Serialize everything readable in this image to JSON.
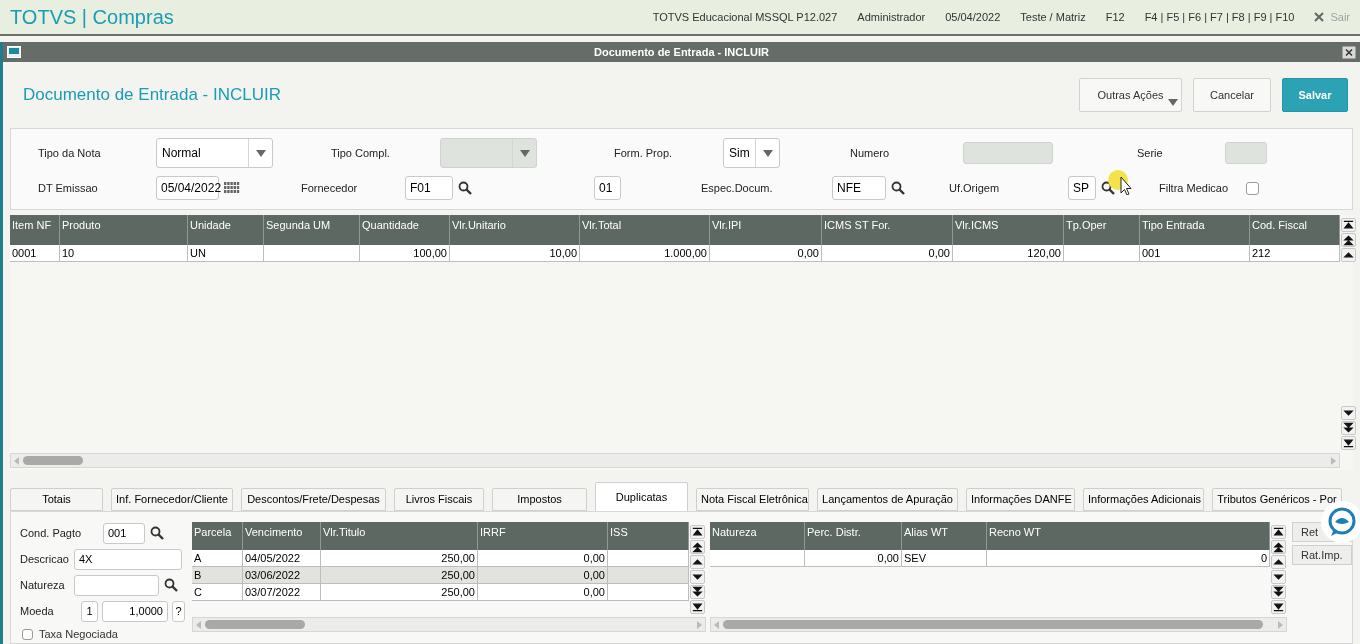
{
  "app_bar": {
    "title": "TOTVS | Compras",
    "items": [
      "TOTVS Educacional MSSQL P12.027",
      "Administrador",
      "05/04/2022",
      "Teste / Matriz",
      "F12",
      "F4 | F5 | F6 | F7 | F8 | F9 | F10"
    ],
    "exit": {
      "label": "Sair",
      "disabled": true
    }
  },
  "window": {
    "title": "Documento de Entrada - INCLUIR"
  },
  "header": {
    "title": "Documento de Entrada - INCLUIR",
    "buttons": [
      {
        "label": "Outras Ações",
        "kind": "menu"
      },
      {
        "label": "Cancelar",
        "kind": "default"
      },
      {
        "label": "Salvar",
        "kind": "primary"
      }
    ]
  },
  "form": {
    "rows": [
      [
        {
          "label": "Tipo da Nota",
          "kind": "select",
          "value": "Normal",
          "disabled": false
        },
        {
          "label": "Tipo Compl.",
          "kind": "select",
          "disabled": true
        },
        {
          "label": "Form. Prop.",
          "kind": "select",
          "value": "Sim",
          "disabled": false
        },
        {
          "label": "Numero",
          "kind": "input",
          "disabled": true
        },
        {
          "label": "Serie",
          "kind": "input",
          "disabled": true
        }
      ],
      [
        {
          "label": "DT Emissao",
          "kind": "date",
          "value": "05/04/2022",
          "disabled": false
        },
        {
          "label": "Fornecedor",
          "kind": "lookup",
          "value": "F01",
          "disabled": false
        },
        {
          "kind": "input",
          "value": "01",
          "disabled": false
        },
        {
          "label": "Espec.Docum.",
          "kind": "lookup",
          "value": "NFE",
          "disabled": false
        },
        {
          "label": "Uf.Origem",
          "kind": "lookup",
          "value": "SP",
          "disabled": false
        },
        {
          "label": "Filtra Medicao",
          "kind": "checkbox",
          "checked": false
        }
      ]
    ]
  },
  "items_grid": {
    "columns": [
      {
        "label": "Item NF",
        "kind": "text"
      },
      {
        "label": "Produto",
        "kind": "text"
      },
      {
        "label": "Unidade",
        "kind": "text"
      },
      {
        "label": "Segunda UM",
        "kind": "text"
      },
      {
        "label": "Quantidade",
        "kind": "number"
      },
      {
        "label": "Vlr.Unitario",
        "kind": "number"
      },
      {
        "label": "Vlr.Total",
        "kind": "number"
      },
      {
        "label": "Vlr.IPI",
        "kind": "number"
      },
      {
        "label": "ICMS ST For.",
        "kind": "number"
      },
      {
        "label": "Vlr.ICMS",
        "kind": "number"
      },
      {
        "label": "Tp.Oper",
        "kind": "text"
      },
      {
        "label": "Tipo Entrada",
        "kind": "text"
      },
      {
        "label": "Cod. Fiscal",
        "kind": "text"
      }
    ],
    "rows": [
      {
        "cells": [
          "0001",
          "10",
          "UN",
          "",
          "100,00",
          "10,00",
          "1.000,00",
          "0,00",
          "0,00",
          "120,00",
          "",
          "001",
          "212"
        ],
        "selected": false
      }
    ]
  },
  "tabs": [
    {
      "label": "Totais",
      "selected": false
    },
    {
      "label": "Inf. Fornecedor/Cliente",
      "selected": false
    },
    {
      "label": "Descontos/Frete/Despesas",
      "selected": false
    },
    {
      "label": "Livros Fiscais",
      "selected": false
    },
    {
      "label": "Impostos",
      "selected": false
    },
    {
      "label": "Duplicatas",
      "selected": true
    },
    {
      "label": "Nota Fiscal Eletrônica",
      "selected": false
    },
    {
      "label": "Lançamentos de Apuração",
      "selected": false
    },
    {
      "label": "Informações DANFE",
      "selected": false
    },
    {
      "label": "Informações Adicionais",
      "selected": false
    },
    {
      "label": "Tributos Genéricos - Por",
      "selected": false
    }
  ],
  "payment": {
    "fields": [
      {
        "label": "Cond. Pagto",
        "kind": "lookup",
        "value": "001"
      },
      {
        "label": "Descricao",
        "kind": "input",
        "value": "4X"
      },
      {
        "label": "Natureza",
        "kind": "lookup"
      },
      {
        "label": "Moeda",
        "kind": "currency",
        "value": "1",
        "rate": "1,0000",
        "help": "?"
      }
    ],
    "checkbox": {
      "label": "Taxa Negociada",
      "checked": false
    }
  },
  "installments_grid": {
    "columns": [
      {
        "label": "Parcela",
        "kind": "text"
      },
      {
        "label": "Vencimento",
        "kind": "text"
      },
      {
        "label": "Vlr.Titulo",
        "kind": "number"
      },
      {
        "label": "IRRF",
        "kind": "number"
      },
      {
        "label": "ISS",
        "kind": "number"
      }
    ],
    "rows": [
      {
        "cells": [
          "A",
          "04/05/2022",
          "250,00",
          "0,00",
          ""
        ],
        "selected": false
      },
      {
        "cells": [
          "B",
          "03/06/2022",
          "250,00",
          "0,00",
          ""
        ],
        "selected": true
      },
      {
        "cells": [
          "C",
          "03/07/2022",
          "250,00",
          "0,00",
          ""
        ],
        "selected": false
      }
    ]
  },
  "nature_grid": {
    "columns": [
      {
        "label": "Natureza",
        "kind": "text"
      },
      {
        "label": "Perc. Distr.",
        "kind": "number"
      },
      {
        "label": "Alias WT",
        "kind": "text"
      },
      {
        "label": "Recno WT",
        "kind": "number"
      }
    ],
    "rows": [
      {
        "cells": [
          "",
          "0,00",
          "SEV",
          "0"
        ],
        "selected": false
      }
    ]
  },
  "side_buttons": [
    "Ret",
    "Rat.Imp."
  ]
}
